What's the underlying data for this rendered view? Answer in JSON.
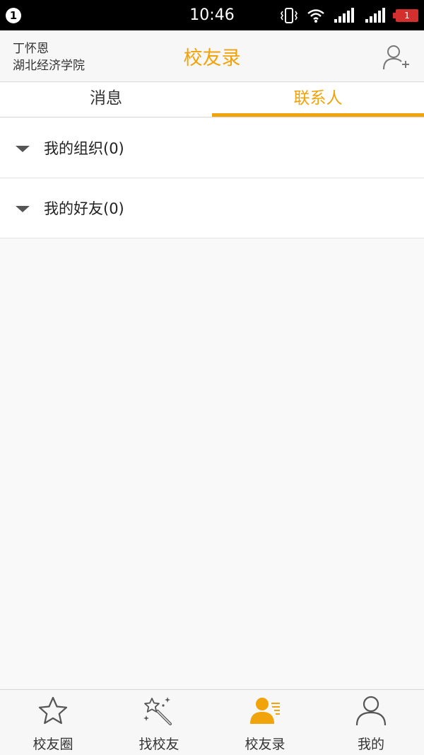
{
  "status_bar": {
    "notification_count": "1",
    "time": "10:46",
    "battery_level": "1"
  },
  "header": {
    "user_name": "丁怀恩",
    "school": "湖北经济学院",
    "title": "校友录"
  },
  "tabs": [
    {
      "label": "消息",
      "active": false
    },
    {
      "label": "联系人",
      "active": true
    }
  ],
  "groups": [
    {
      "label": "我的组织(0)"
    },
    {
      "label": "我的好友(0)"
    }
  ],
  "bottom_nav": [
    {
      "label": "校友圈",
      "icon": "star-icon",
      "active": false
    },
    {
      "label": "找校友",
      "icon": "magic-wand-icon",
      "active": false
    },
    {
      "label": "校友录",
      "icon": "contacts-icon",
      "active": true
    },
    {
      "label": "我的",
      "icon": "person-icon",
      "active": false
    }
  ],
  "colors": {
    "accent": "#f0a30a",
    "status_bar": "#000000",
    "battery": "#d32f2f"
  }
}
